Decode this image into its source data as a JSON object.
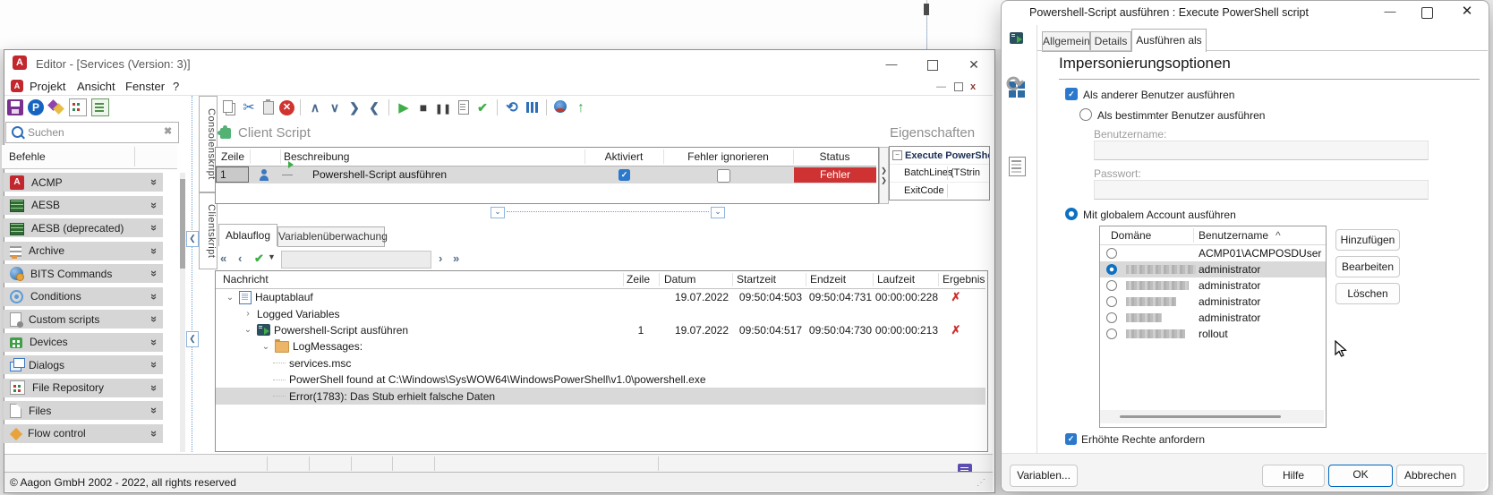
{
  "colors": {
    "accent": "#0067c0",
    "error_red": "#ce3232",
    "selection_gray": "#d9d9d9",
    "success_green": "#3fae49"
  },
  "editor": {
    "title": "Editor - [Services (Version: 3)]",
    "menu": [
      "Projekt",
      "Ansicht",
      "Fenster",
      "?"
    ],
    "quick_toolbar_icons": [
      "save",
      "profile-p",
      "layers",
      "file-repository",
      "list-view"
    ],
    "search": {
      "placeholder": "Suchen"
    },
    "befehle_header": "Befehle",
    "sidebar": {
      "items": [
        {
          "label": "ACMP",
          "icon": "acmp"
        },
        {
          "label": "AESB",
          "icon": "aesb"
        },
        {
          "label": "AESB (deprecated)",
          "icon": "aesb"
        },
        {
          "label": "Archive",
          "icon": "archive"
        },
        {
          "label": "BITS Commands",
          "icon": "bits"
        },
        {
          "label": "Conditions",
          "icon": "conditions"
        },
        {
          "label": "Custom scripts",
          "icon": "custom-scripts"
        },
        {
          "label": "Devices",
          "icon": "devices"
        },
        {
          "label": "Dialogs",
          "icon": "dialogs"
        },
        {
          "label": "File Repository",
          "icon": "file-repository"
        },
        {
          "label": "Files",
          "icon": "files"
        },
        {
          "label": "Flow control",
          "icon": "flow-control"
        }
      ]
    },
    "vertical_tabs": [
      "Consolenskript",
      "Clientskript"
    ],
    "client_toolbar_icons": [
      "copy",
      "cut",
      "paste",
      "delete",
      "|",
      "move-up",
      "move-down",
      "move-right",
      "move-left",
      "|",
      "run",
      "stop",
      "pause",
      "report",
      "validate",
      "|",
      "history",
      "columns",
      "|",
      "browser",
      "upload"
    ],
    "client_script": {
      "header": "Client Script",
      "columns": [
        "Zeile",
        "Beschreibung",
        "Aktiviert",
        "Fehler ignorieren",
        "Status"
      ],
      "row": {
        "zeile": "1",
        "beschreibung": "Powershell-Script ausführen",
        "aktiviert": true,
        "fehler_ignorieren": false,
        "status": "Fehler"
      }
    },
    "eigenschaften": {
      "title": "Eigenschaften",
      "root": "Execute PowerShell script",
      "props": [
        {
          "name": "BatchLines",
          "value": "(TStrin"
        },
        {
          "name": "ExitCode",
          "value": ""
        }
      ]
    },
    "log_tabs": [
      "Ablauflog",
      "Variablenüberwachung"
    ],
    "log": {
      "columns": [
        "Nachricht",
        "Zeile",
        "Datum",
        "Startzeit",
        "Endzeit",
        "Laufzeit",
        "Ergebnis"
      ],
      "rows": [
        {
          "text": "Hauptablauf",
          "level": 0,
          "icon": "notebook",
          "expander": "open",
          "zeile": "",
          "datum": "19.07.2022",
          "startzeit": "09:50:04:503",
          "endzeit": "09:50:04:731",
          "laufzeit": "00:00:00:228",
          "ergebnis": "error",
          "selected": false
        },
        {
          "text": "Logged Variables",
          "level": 1,
          "icon": "",
          "expander": "closed",
          "zeile": "",
          "datum": "",
          "startzeit": "",
          "endzeit": "",
          "laufzeit": "",
          "ergebnis": "",
          "selected": false
        },
        {
          "text": "Powershell-Script ausführen",
          "level": 1,
          "icon": "powershell",
          "expander": "open",
          "zeile": "1",
          "datum": "19.07.2022",
          "startzeit": "09:50:04:517",
          "endzeit": "09:50:04:730",
          "laufzeit": "00:00:00:213",
          "ergebnis": "error",
          "selected": false
        },
        {
          "text": "LogMessages:",
          "level": 2,
          "icon": "folder",
          "expander": "open",
          "zeile": "",
          "datum": "",
          "startzeit": "",
          "endzeit": "",
          "laufzeit": "",
          "ergebnis": "",
          "selected": false
        },
        {
          "text": "services.msc",
          "level": 3,
          "icon": "",
          "expander": "",
          "zeile": "",
          "datum": "",
          "startzeit": "",
          "endzeit": "",
          "laufzeit": "",
          "ergebnis": "",
          "selected": false
        },
        {
          "text": "PowerShell found at C:\\Windows\\SysWOW64\\WindowsPowerShell\\v1.0\\powershell.exe",
          "level": 3,
          "icon": "",
          "expander": "",
          "zeile": "",
          "datum": "",
          "startzeit": "",
          "endzeit": "",
          "laufzeit": "",
          "ergebnis": "",
          "selected": false
        },
        {
          "text": "Error(1783): Das Stub erhielt falsche Daten",
          "level": 3,
          "icon": "",
          "expander": "",
          "zeile": "",
          "datum": "",
          "startzeit": "",
          "endzeit": "",
          "laufzeit": "",
          "ergebnis": "",
          "selected": true
        }
      ]
    },
    "statusbar_copyright": "© Aagon GmbH 2002 - 2022, all rights reserved"
  },
  "dialog": {
    "title": "Powershell-Script ausführen : Execute PowerShell script",
    "tabs": [
      "Allgemein",
      "Details",
      "Ausführen als"
    ],
    "active_tab": "Ausführen als",
    "heading": "Impersonierungsoptionen",
    "chk_other_user": "Als anderer Benutzer ausführen",
    "radio_specific_user": "Als bestimmter Benutzer ausführen",
    "lbl_username": "Benutzername:",
    "lbl_password": "Passwort:",
    "username_value": "",
    "password_value": "",
    "radio_global_account": "Mit globalem Account ausführen",
    "accounts_table": {
      "columns": [
        "Domäne",
        "Benutzername"
      ],
      "sort_indicator": "^",
      "rows": [
        {
          "domain": "",
          "domain_redacted": false,
          "blur_width": 0,
          "username": "ACMP01\\ACMPOSDUser",
          "selected": false
        },
        {
          "domain": "",
          "domain_redacted": true,
          "blur_width": 78,
          "username": "administrator",
          "selected": true
        },
        {
          "domain": "",
          "domain_redacted": true,
          "blur_width": 70,
          "username": "administrator",
          "selected": false
        },
        {
          "domain": "",
          "domain_redacted": true,
          "blur_width": 56,
          "username": "administrator",
          "selected": false
        },
        {
          "domain": "",
          "domain_redacted": true,
          "blur_width": 40,
          "username": "administrator",
          "selected": false
        },
        {
          "domain": "",
          "domain_redacted": true,
          "blur_width": 66,
          "username": "rollout",
          "selected": false
        }
      ]
    },
    "side_buttons": {
      "add": "Hinzufügen",
      "edit": "Bearbeiten",
      "delete": "Löschen"
    },
    "chk_elevated": "Erhöhte Rechte anfordern",
    "footer": {
      "variables": "Variablen...",
      "help": "Hilfe",
      "ok": "OK",
      "cancel": "Abbrechen"
    }
  }
}
